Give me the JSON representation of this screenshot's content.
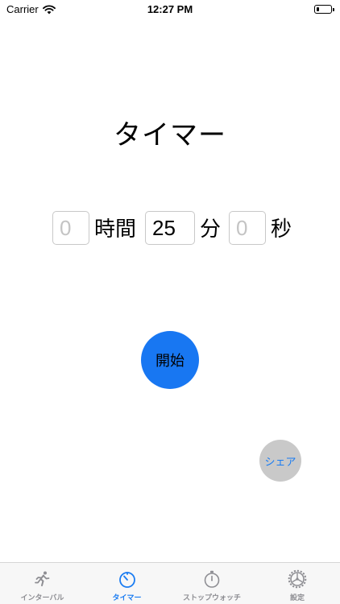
{
  "status_bar": {
    "carrier": "Carrier",
    "time": "12:27 PM",
    "battery_level": 0.2
  },
  "screen": {
    "title": "タイマー"
  },
  "timer": {
    "hours_placeholder": "0",
    "hours_unit": "時間",
    "minutes_value": "25",
    "minutes_unit": "分",
    "seconds_placeholder": "0",
    "seconds_unit": "秒"
  },
  "buttons": {
    "start_label": "開始",
    "share_label": "シェア"
  },
  "tabs": [
    {
      "label": "インターバル",
      "icon": "runner-icon",
      "active": false
    },
    {
      "label": "タイマー",
      "icon": "timer-icon",
      "active": true
    },
    {
      "label": "ストップウォッチ",
      "icon": "stopwatch-icon",
      "active": false
    },
    {
      "label": "設定",
      "icon": "settings-icon",
      "active": false
    }
  ],
  "colors": {
    "accent": "#1a7cf2",
    "start_button": "#1877f2",
    "share_button": "#c9c9c9",
    "inactive_tab": "#8e8e93"
  }
}
